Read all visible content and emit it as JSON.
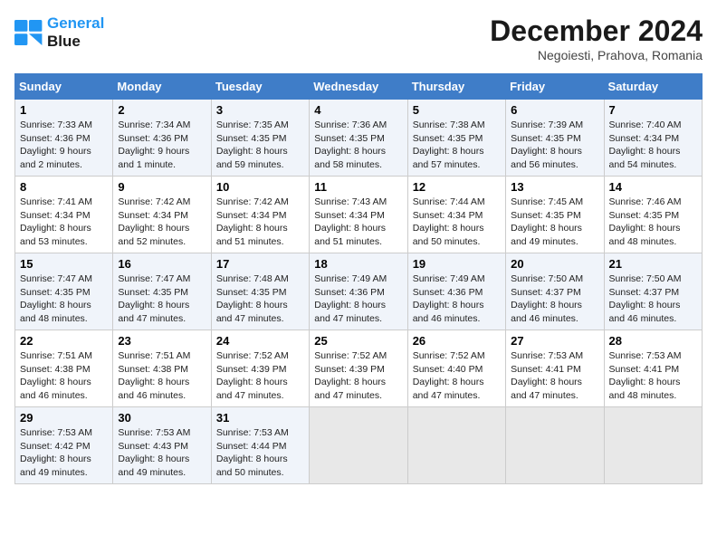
{
  "header": {
    "logo_line1": "General",
    "logo_line2": "Blue",
    "month": "December 2024",
    "location": "Negoiesti, Prahova, Romania"
  },
  "weekdays": [
    "Sunday",
    "Monday",
    "Tuesday",
    "Wednesday",
    "Thursday",
    "Friday",
    "Saturday"
  ],
  "weeks": [
    [
      {
        "day": "1",
        "sunrise": "7:33 AM",
        "sunset": "4:36 PM",
        "daylight": "9 hours and 2 minutes."
      },
      {
        "day": "2",
        "sunrise": "7:34 AM",
        "sunset": "4:36 PM",
        "daylight": "9 hours and 1 minute."
      },
      {
        "day": "3",
        "sunrise": "7:35 AM",
        "sunset": "4:35 PM",
        "daylight": "8 hours and 59 minutes."
      },
      {
        "day": "4",
        "sunrise": "7:36 AM",
        "sunset": "4:35 PM",
        "daylight": "8 hours and 58 minutes."
      },
      {
        "day": "5",
        "sunrise": "7:38 AM",
        "sunset": "4:35 PM",
        "daylight": "8 hours and 57 minutes."
      },
      {
        "day": "6",
        "sunrise": "7:39 AM",
        "sunset": "4:35 PM",
        "daylight": "8 hours and 56 minutes."
      },
      {
        "day": "7",
        "sunrise": "7:40 AM",
        "sunset": "4:34 PM",
        "daylight": "8 hours and 54 minutes."
      }
    ],
    [
      {
        "day": "8",
        "sunrise": "7:41 AM",
        "sunset": "4:34 PM",
        "daylight": "8 hours and 53 minutes."
      },
      {
        "day": "9",
        "sunrise": "7:42 AM",
        "sunset": "4:34 PM",
        "daylight": "8 hours and 52 minutes."
      },
      {
        "day": "10",
        "sunrise": "7:42 AM",
        "sunset": "4:34 PM",
        "daylight": "8 hours and 51 minutes."
      },
      {
        "day": "11",
        "sunrise": "7:43 AM",
        "sunset": "4:34 PM",
        "daylight": "8 hours and 51 minutes."
      },
      {
        "day": "12",
        "sunrise": "7:44 AM",
        "sunset": "4:34 PM",
        "daylight": "8 hours and 50 minutes."
      },
      {
        "day": "13",
        "sunrise": "7:45 AM",
        "sunset": "4:35 PM",
        "daylight": "8 hours and 49 minutes."
      },
      {
        "day": "14",
        "sunrise": "7:46 AM",
        "sunset": "4:35 PM",
        "daylight": "8 hours and 48 minutes."
      }
    ],
    [
      {
        "day": "15",
        "sunrise": "7:47 AM",
        "sunset": "4:35 PM",
        "daylight": "8 hours and 48 minutes."
      },
      {
        "day": "16",
        "sunrise": "7:47 AM",
        "sunset": "4:35 PM",
        "daylight": "8 hours and 47 minutes."
      },
      {
        "day": "17",
        "sunrise": "7:48 AM",
        "sunset": "4:35 PM",
        "daylight": "8 hours and 47 minutes."
      },
      {
        "day": "18",
        "sunrise": "7:49 AM",
        "sunset": "4:36 PM",
        "daylight": "8 hours and 47 minutes."
      },
      {
        "day": "19",
        "sunrise": "7:49 AM",
        "sunset": "4:36 PM",
        "daylight": "8 hours and 46 minutes."
      },
      {
        "day": "20",
        "sunrise": "7:50 AM",
        "sunset": "4:37 PM",
        "daylight": "8 hours and 46 minutes."
      },
      {
        "day": "21",
        "sunrise": "7:50 AM",
        "sunset": "4:37 PM",
        "daylight": "8 hours and 46 minutes."
      }
    ],
    [
      {
        "day": "22",
        "sunrise": "7:51 AM",
        "sunset": "4:38 PM",
        "daylight": "8 hours and 46 minutes."
      },
      {
        "day": "23",
        "sunrise": "7:51 AM",
        "sunset": "4:38 PM",
        "daylight": "8 hours and 46 minutes."
      },
      {
        "day": "24",
        "sunrise": "7:52 AM",
        "sunset": "4:39 PM",
        "daylight": "8 hours and 47 minutes."
      },
      {
        "day": "25",
        "sunrise": "7:52 AM",
        "sunset": "4:39 PM",
        "daylight": "8 hours and 47 minutes."
      },
      {
        "day": "26",
        "sunrise": "7:52 AM",
        "sunset": "4:40 PM",
        "daylight": "8 hours and 47 minutes."
      },
      {
        "day": "27",
        "sunrise": "7:53 AM",
        "sunset": "4:41 PM",
        "daylight": "8 hours and 47 minutes."
      },
      {
        "day": "28",
        "sunrise": "7:53 AM",
        "sunset": "4:41 PM",
        "daylight": "8 hours and 48 minutes."
      }
    ],
    [
      {
        "day": "29",
        "sunrise": "7:53 AM",
        "sunset": "4:42 PM",
        "daylight": "8 hours and 49 minutes."
      },
      {
        "day": "30",
        "sunrise": "7:53 AM",
        "sunset": "4:43 PM",
        "daylight": "8 hours and 49 minutes."
      },
      {
        "day": "31",
        "sunrise": "7:53 AM",
        "sunset": "4:44 PM",
        "daylight": "8 hours and 50 minutes."
      },
      null,
      null,
      null,
      null
    ]
  ]
}
